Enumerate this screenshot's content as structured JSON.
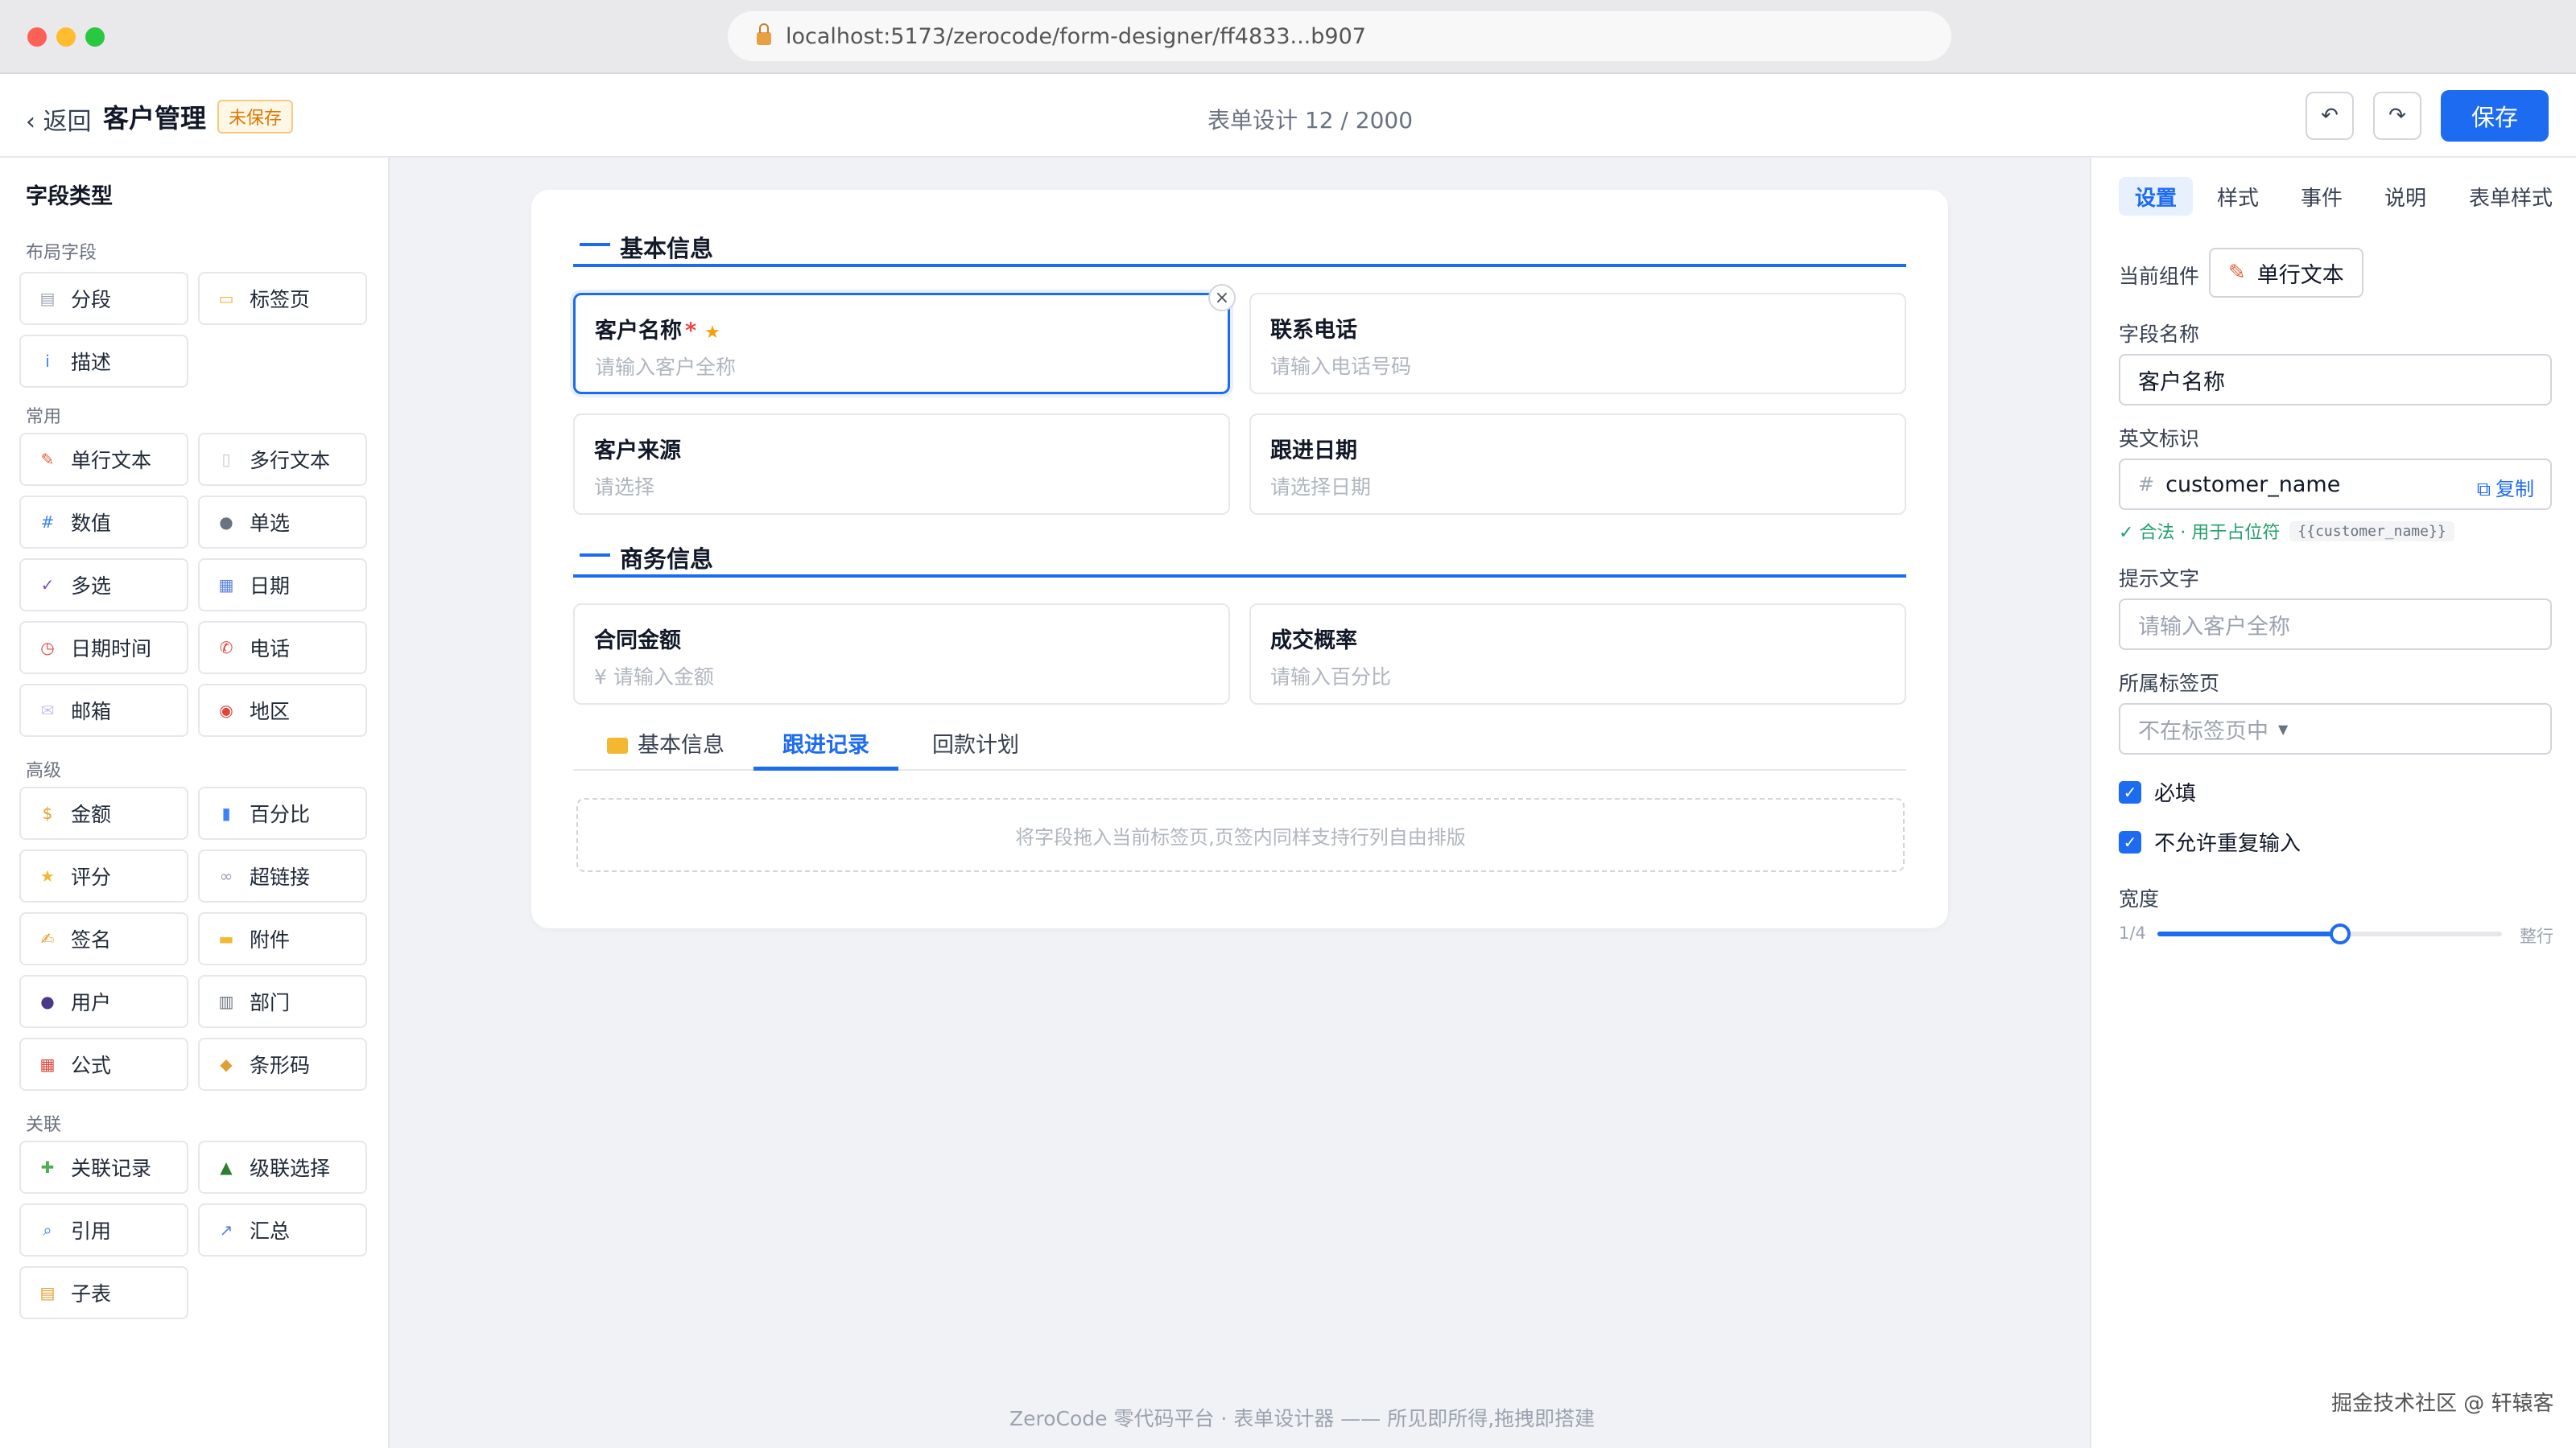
{
  "browser": {
    "url": "localhost:5173/zerocode/form-designer/ff4833...b907"
  },
  "header": {
    "back_label": "‹ 返回",
    "title": "客户管理",
    "unsaved_badge": "未保存",
    "design_count": "表单设计 12 / 2000",
    "undo_icon": "↶",
    "redo_icon": "↷",
    "save_label": "保存"
  },
  "left": {
    "title": "字段类型",
    "groups": {
      "layout": "布局字段",
      "common": "常用",
      "advanced": "高级",
      "relation": "关联"
    },
    "items": [
      {
        "label": "分段",
        "icon": "▤",
        "color": "#9ca3af"
      },
      {
        "label": "标签页",
        "icon": "▭",
        "color": "#f4b731"
      },
      {
        "label": "描述",
        "icon": "i",
        "color": "#3b82f6"
      },
      {
        "label": "单行文本",
        "icon": "✎",
        "color": "#e35d3a"
      },
      {
        "label": "多行文本",
        "icon": "▯",
        "color": "#c7c9d1"
      },
      {
        "label": "数值",
        "icon": "#",
        "color": "#3b82f6"
      },
      {
        "label": "单选",
        "icon": "●",
        "color": "#6b7280"
      },
      {
        "label": "多选",
        "icon": "✓",
        "color": "#7c4dbd"
      },
      {
        "label": "日期",
        "icon": "▦",
        "color": "#5b7fe0"
      },
      {
        "label": "日期时间",
        "icon": "◷",
        "color": "#e0453a"
      },
      {
        "label": "电话",
        "icon": "✆",
        "color": "#e0453a"
      },
      {
        "label": "邮箱",
        "icon": "✉",
        "color": "#c9c3e6"
      },
      {
        "label": "地区",
        "icon": "◉",
        "color": "#e0453a"
      },
      {
        "label": "金额",
        "icon": "$",
        "color": "#e0a030"
      },
      {
        "label": "百分比",
        "icon": "▮",
        "color": "#3b82f6"
      },
      {
        "label": "评分",
        "icon": "★",
        "color": "#f4b731"
      },
      {
        "label": "超链接",
        "icon": "∞",
        "color": "#9ca3af"
      },
      {
        "label": "签名",
        "icon": "✍",
        "color": "#e0a030"
      },
      {
        "label": "附件",
        "icon": "▬",
        "color": "#f4b731"
      },
      {
        "label": "用户",
        "icon": "●",
        "color": "#4b3a8c"
      },
      {
        "label": "部门",
        "icon": "▥",
        "color": "#6b7280"
      },
      {
        "label": "公式",
        "icon": "▦",
        "color": "#e0453a"
      },
      {
        "label": "条形码",
        "icon": "◆",
        "color": "#e0a030"
      },
      {
        "label": "关联记录",
        "icon": "✚",
        "color": "#4caf50"
      },
      {
        "label": "级联选择",
        "icon": "▲",
        "color": "#2e7d32"
      },
      {
        "label": "引用",
        "icon": "⌕",
        "color": "#3b82f6"
      },
      {
        "label": "汇总",
        "icon": "↗",
        "color": "#5b7fe0"
      },
      {
        "label": "子表",
        "icon": "▤",
        "color": "#e0a030"
      }
    ]
  },
  "canvas": {
    "section1": "基本信息",
    "section2": "商务信息",
    "fields": [
      {
        "label": "客户名称",
        "placeholder": "请输入客户全称",
        "required_mark": "*",
        "star": "★"
      },
      {
        "label": "联系电话",
        "placeholder": "请输入电话号码"
      },
      {
        "label": "客户来源",
        "placeholder": "请选择"
      },
      {
        "label": "跟进日期",
        "placeholder": "请选择日期"
      },
      {
        "label": "合同金额",
        "placeholder": "¥ 请输入金额"
      },
      {
        "label": "成交概率",
        "placeholder": "请输入百分比"
      }
    ],
    "close_icon": "×",
    "tabs": [
      {
        "label": "基本信息",
        "icon": "folder-icon"
      },
      {
        "label": "跟进记录"
      },
      {
        "label": "回款计划"
      }
    ],
    "drop_hint": "将字段拖入当前标签页,页签内同样支持行列自由排版"
  },
  "footer": "ZeroCode 零代码平台 · 表单设计器 —— 所见即所得,拖拽即搭建",
  "right": {
    "tabs": [
      "设置",
      "样式",
      "事件",
      "说明",
      "表单样式"
    ],
    "current_component_label": "当前组件",
    "current_component": "单行文本",
    "field_name_label": "字段名称",
    "field_name_value": "客户名称",
    "english_id_label": "英文标识",
    "hash": "#",
    "english_id_value": "customer_name",
    "copy_label": "复制",
    "valid_text": "✓ 合法 · 用于占位符",
    "placeholder_code": "{{customer_name}}",
    "hint_label": "提示文字",
    "hint_value": "请输入客户全称",
    "tab_belong_label": "所属标签页",
    "tab_belong_value": "不在标签页中",
    "required_label": "必填",
    "no_duplicate_label": "不允许重复输入",
    "width_label": "宽度",
    "width_min": "1/4",
    "width_max": "整行",
    "width_value": 0.53
  },
  "watermark": "掘金技术社区 @ 轩辕客",
  "colors": {
    "accent": "#1d6bf0",
    "warning": "#d97706",
    "success": "#22a06b"
  }
}
